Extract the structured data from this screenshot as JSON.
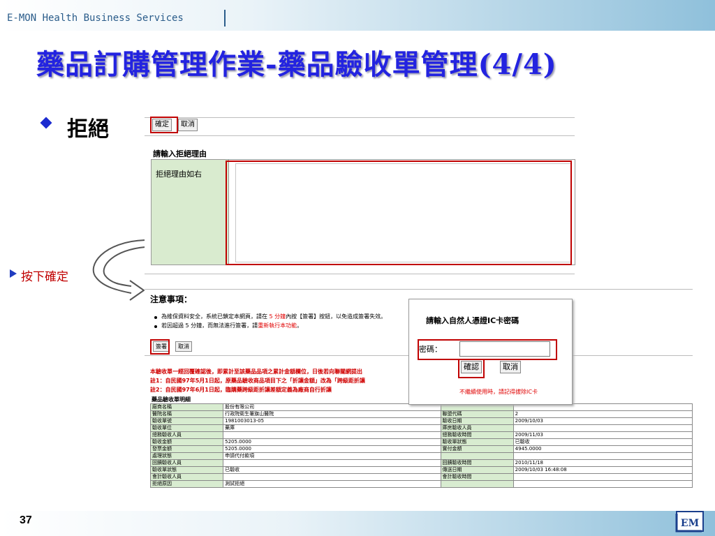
{
  "header": {
    "brand": "E-MON Health Business Services"
  },
  "slide": {
    "title": "藥品訂購管理作業-藥品驗收單管理(4/4)",
    "bullet": "拒絕",
    "sub_bullet": "按下確定",
    "page_number": "37",
    "logo_text": "EM"
  },
  "reject_form": {
    "confirm_label": "確定",
    "cancel_label": "取消",
    "heading": "請輸入拒絕理由",
    "reason_label": "拒絕理由如右",
    "reason_value": ""
  },
  "notice": {
    "heading": "注意事項：",
    "line1_a": "為維保資料安全，系統已鎖定本網頁，請在 ",
    "line1_b": "5 分鐘",
    "line1_c": "內按【簽署】按鈕，以免造成簽署失效。",
    "line2_a": "若因超過 5 分鐘，而無法進行簽署，請",
    "line2_b": "重新執行本功能",
    "line2_c": "。",
    "sign_label": "簽署",
    "cancel_label": "取消",
    "red1": "本驗收單一經回覆確認後，即累計至該藥品品項之累計金額欄位，日後若向聯關網提出",
    "red2": "註1：自民國97年5月1日起，原藥品驗收商品項目下之「折讓金額」改為「跨級距折讓",
    "red3": "註2：自民國97年6月1日起，臨購藥跨級距折讓差額定義為廠商自行折讓",
    "detail_title": "藥品驗收單明細"
  },
  "detail_table": [
    [
      "廠商名稱",
      "股份有限公司",
      "",
      ""
    ],
    [
      "醫院名稱",
      "行政院衛生署旗山醫院",
      "聯盟代碼",
      "2"
    ],
    [
      "驗收單號",
      "1981003013-05",
      "驗收日期",
      "2009/10/03"
    ],
    [
      "驗收單位",
      "藥庫",
      "庫房驗收人員",
      ""
    ],
    [
      "總務驗收人員",
      "",
      "總務驗收時間",
      "2009/11/03"
    ],
    [
      "驗收金額",
      "5205.0000",
      "驗收單狀態",
      "已驗收"
    ],
    [
      "發票金額",
      "5205.0000",
      "實付金額",
      "4945.0000"
    ],
    [
      "處理狀態",
      "申請代付款項",
      "",
      ""
    ],
    [
      "回饋驗收人員",
      "",
      "回饋驗收時間",
      "2010/11/18"
    ],
    [
      "驗收單狀態",
      "已驗收",
      "傳送日期",
      "2009/10/03 16:48:08"
    ],
    [
      "會計驗收人員",
      "",
      "會計驗收時間",
      ""
    ],
    [
      "拒絕原因",
      "測試拒絕",
      "",
      ""
    ]
  ],
  "ic_dialog": {
    "title": "請輸入自然人憑證IC卡密碼",
    "password_label": "密碼：",
    "password_value": "",
    "confirm_label": "確認",
    "cancel_label": "取消",
    "warning": "不繼續使用時，請記得拔除IC卡"
  },
  "colors": {
    "title": "#2323e0",
    "highlight": "#c00000",
    "label_bg": "#d9ebcf"
  }
}
